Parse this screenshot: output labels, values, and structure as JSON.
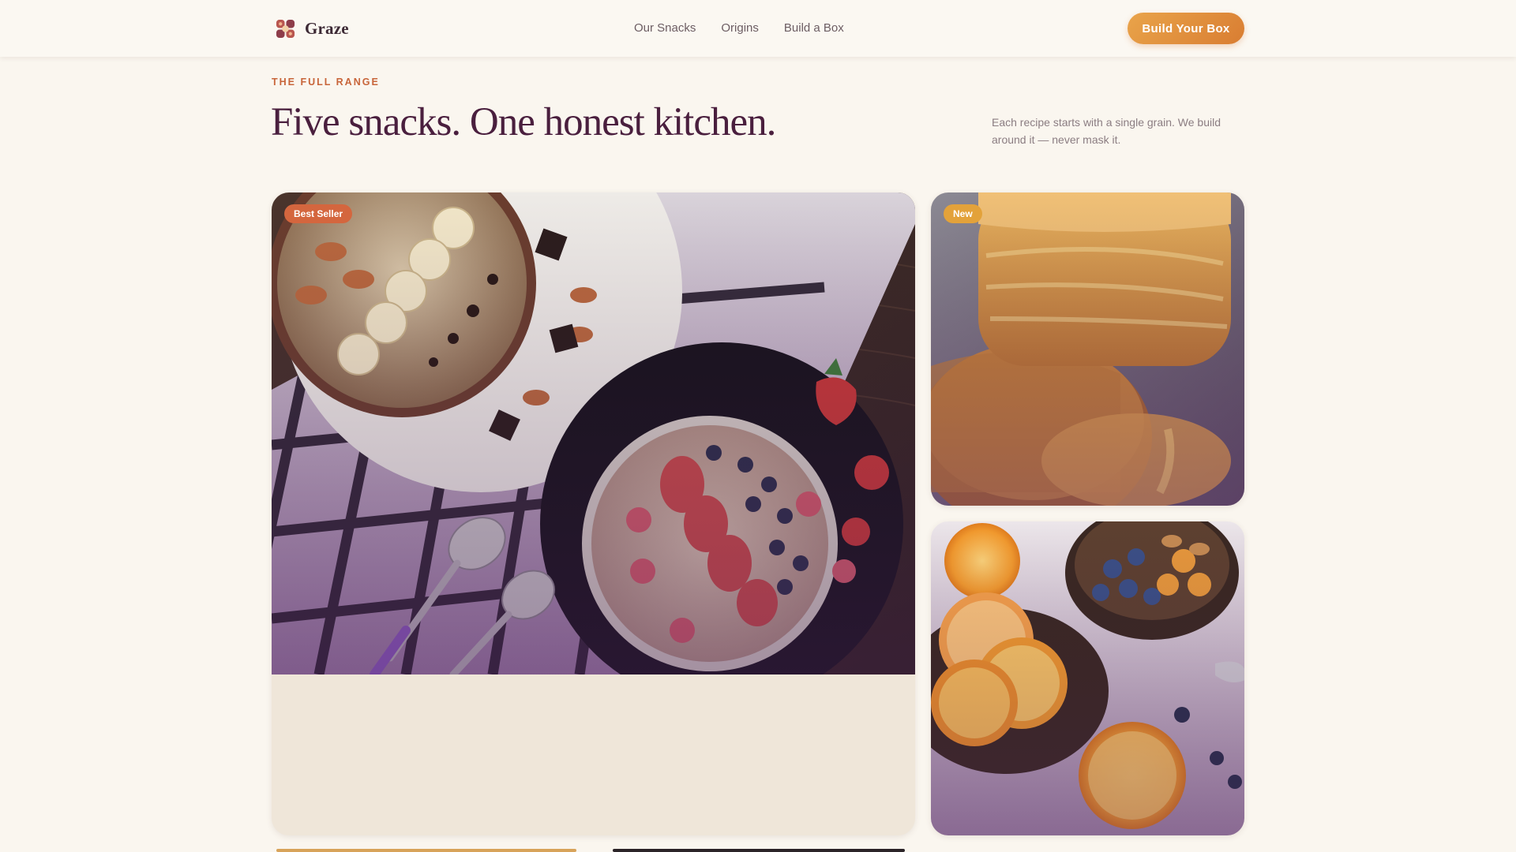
{
  "nav": {
    "brand": "Graze",
    "brand_icon": "knot-logo-icon",
    "links": [
      "Our Snacks",
      "Origins",
      "Build a Box"
    ],
    "cta": "Build Your Box"
  },
  "header": {
    "eyebrow": "THE FULL RANGE",
    "title": "Five snacks. One honest kitchen.",
    "subtitle": "Each recipe starts with a single grain. We build around it — never mask it."
  },
  "products": [
    {
      "badge": "Best Seller",
      "badge_color": "#d4663e",
      "image": "oat-bowls-with-fruit-and-chocolate"
    },
    {
      "badge": "New",
      "badge_color": "#e3a23a",
      "image": "glazed-biscuits"
    },
    {
      "badge": "",
      "image": "citrus-and-berry-bowls"
    }
  ],
  "colors": {
    "background": "#faf6ef",
    "headline": "#4a1f3e",
    "accent": "#c8653a",
    "cta_from": "#e9a44a",
    "cta_to": "#d97d32"
  }
}
